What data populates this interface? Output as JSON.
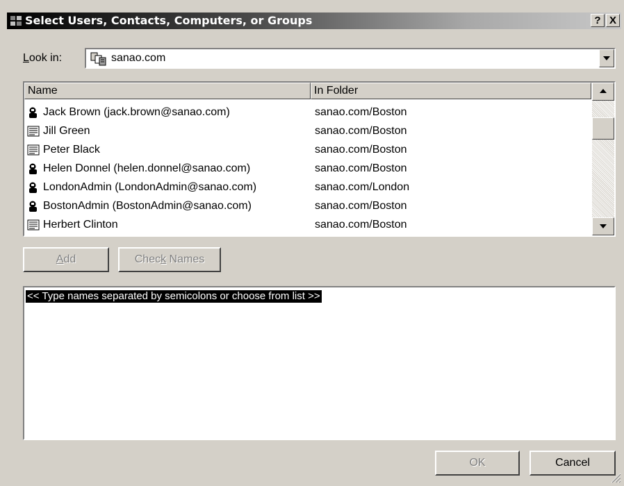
{
  "window": {
    "title": "Select Users, Contacts, Computers, or Groups",
    "help_button": "?",
    "close_button": "X"
  },
  "lookin": {
    "label_accel": "L",
    "label_rest": "ook in:",
    "value": "sanao.com",
    "icon": "domain-icon"
  },
  "list": {
    "columns": [
      "Name",
      "In Folder"
    ],
    "rows": [
      {
        "name": "Jack Brown (jack.brown@sanao.com)",
        "folder": "sanao.com/Boston",
        "icon": "user-icon"
      },
      {
        "name": "Jill Green",
        "folder": "sanao.com/Boston",
        "icon": "contact-icon"
      },
      {
        "name": "Peter Black",
        "folder": "sanao.com/Boston",
        "icon": "contact-icon"
      },
      {
        "name": "Helen Donnel (helen.donnel@sanao.com)",
        "folder": "sanao.com/Boston",
        "icon": "user-icon"
      },
      {
        "name": "LondonAdmin (LondonAdmin@sanao.com)",
        "folder": "sanao.com/London",
        "icon": "user-icon"
      },
      {
        "name": "BostonAdmin (BostonAdmin@sanao.com)",
        "folder": "sanao.com/Boston",
        "icon": "user-icon"
      },
      {
        "name": "Herbert Clinton",
        "folder": "sanao.com/Boston",
        "icon": "contact-icon"
      }
    ]
  },
  "buttons": {
    "add_accel": "A",
    "add_rest": "dd",
    "check_pre": "Chec",
    "check_accel": "k",
    "check_post": " Names",
    "ok": "OK",
    "cancel": "Cancel"
  },
  "names_box": {
    "hint": "<< Type names separated by semicolons or choose from list >>"
  },
  "colors": {
    "face": "#d4d0c8",
    "shadow": "#808080",
    "highlight": "#ffffff",
    "text": "#000000"
  }
}
